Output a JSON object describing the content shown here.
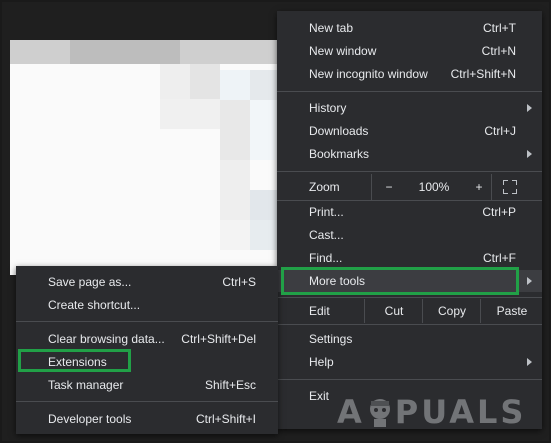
{
  "main_menu": {
    "group1": [
      {
        "label": "New tab",
        "shortcut": "Ctrl+T"
      },
      {
        "label": "New window",
        "shortcut": "Ctrl+N"
      },
      {
        "label": "New incognito window",
        "shortcut": "Ctrl+Shift+N"
      }
    ],
    "group2": [
      {
        "label": "History",
        "shortcut": "",
        "submenu": true
      },
      {
        "label": "Downloads",
        "shortcut": "Ctrl+J"
      },
      {
        "label": "Bookmarks",
        "shortcut": "",
        "submenu": true
      }
    ],
    "zoom": {
      "label": "Zoom",
      "minus": "−",
      "value": "100%",
      "plus": "+"
    },
    "group3": [
      {
        "label": "Print...",
        "shortcut": "Ctrl+P"
      },
      {
        "label": "Cast...",
        "shortcut": ""
      },
      {
        "label": "Find...",
        "shortcut": "Ctrl+F"
      },
      {
        "label": "More tools",
        "shortcut": "",
        "submenu": true
      }
    ],
    "edit": {
      "label": "Edit",
      "cut": "Cut",
      "copy": "Copy",
      "paste": "Paste"
    },
    "group4": [
      {
        "label": "Settings",
        "shortcut": ""
      },
      {
        "label": "Help",
        "shortcut": "",
        "submenu": true
      }
    ],
    "exit": {
      "label": "Exit"
    }
  },
  "more_tools_menu": {
    "group1": [
      {
        "label": "Save page as...",
        "shortcut": "Ctrl+S"
      },
      {
        "label": "Create shortcut...",
        "shortcut": ""
      }
    ],
    "group2": [
      {
        "label": "Clear browsing data...",
        "shortcut": "Ctrl+Shift+Del"
      },
      {
        "label": "Extensions",
        "shortcut": ""
      },
      {
        "label": "Task manager",
        "shortcut": "Shift+Esc"
      }
    ],
    "group3": [
      {
        "label": "Developer tools",
        "shortcut": "Ctrl+Shift+I"
      }
    ]
  },
  "watermark": {
    "left": "A",
    "right": "PUALS"
  },
  "colors": {
    "menu_bg": "#2b2c2f",
    "text": "#e8eaed",
    "highlight": "#21a047"
  }
}
